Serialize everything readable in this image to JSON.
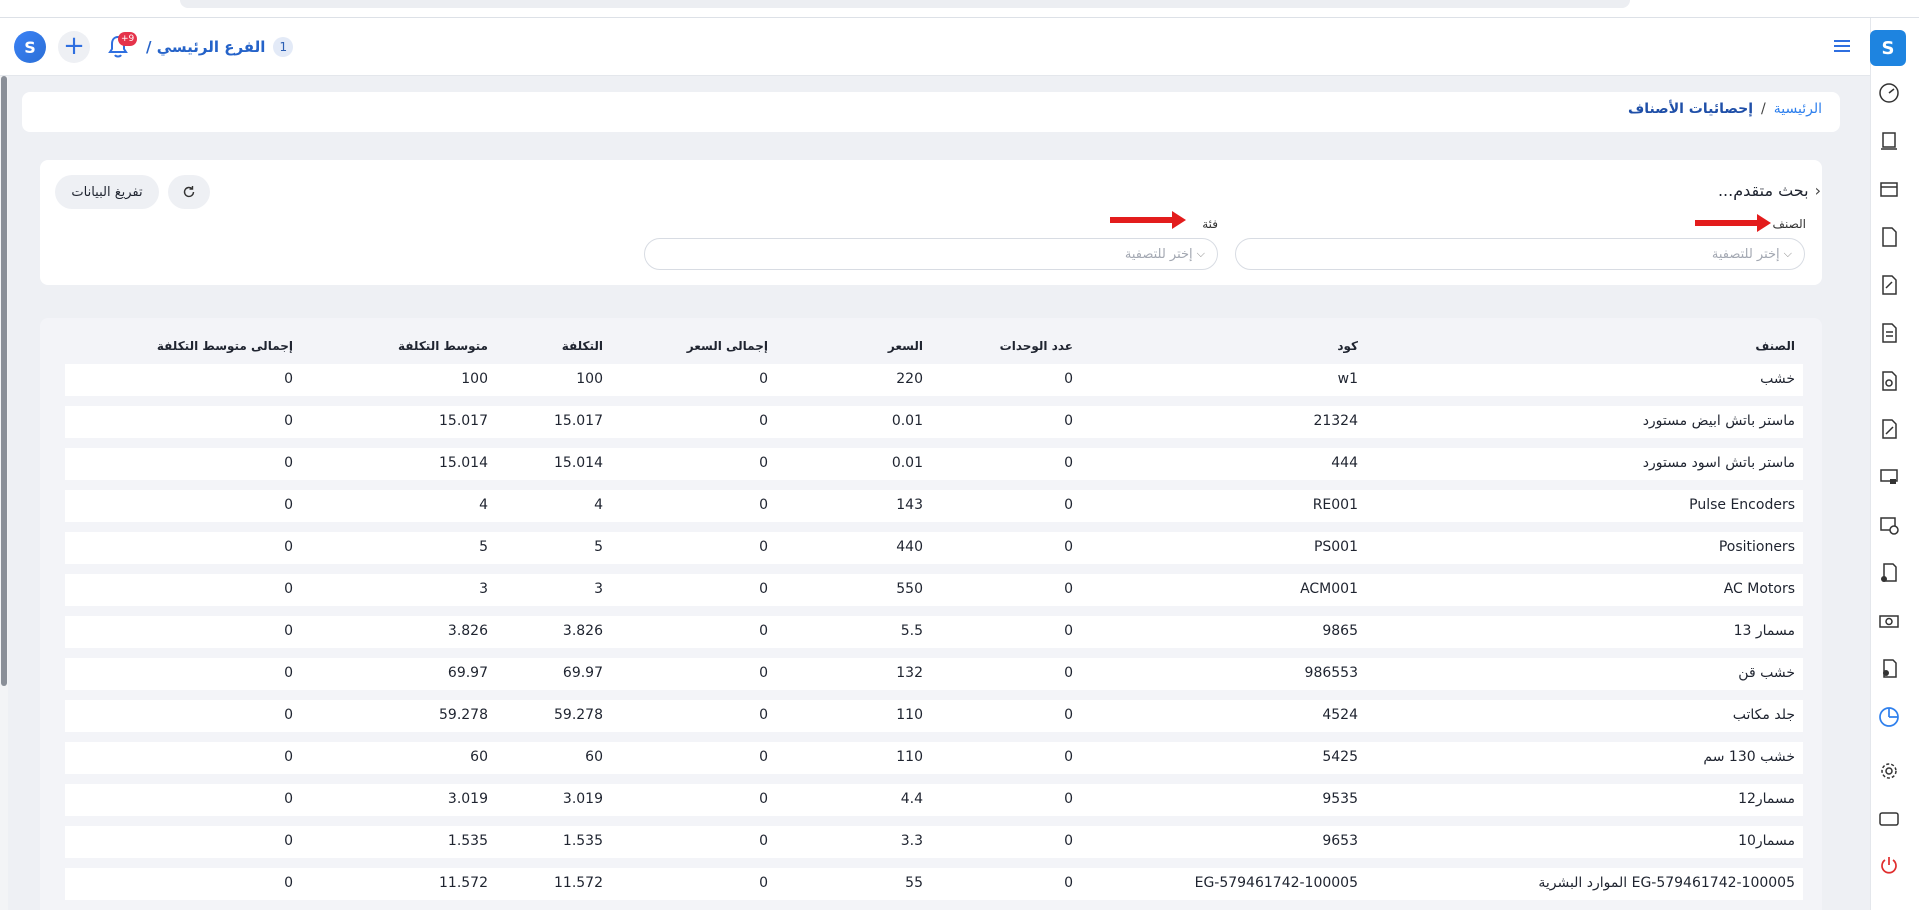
{
  "app": {
    "logo_letter": "S",
    "brand_letter": "S"
  },
  "topbar": {
    "branch_number": "1",
    "branch_name": "الفرع الرئيسي /",
    "notification_count": "+9"
  },
  "breadcrumb": {
    "home": "الرئيسية",
    "separator": "/",
    "current": "إحصائيات الأصناف"
  },
  "filters": {
    "title": "بحث متقدم...",
    "item_label": "الصنف",
    "item_placeholder": "إختر للتصفية",
    "category_label": "فئة",
    "category_placeholder": "إختر للتصفية",
    "export_label": "تفريغ البيانات"
  },
  "table": {
    "headers": {
      "item": "الصنف",
      "code": "كود",
      "units": "عدد الوحدات",
      "price": "السعر",
      "total_price": "إجمالى السعر",
      "cost": "التكلفة",
      "avg_cost": "متوسط التكلفة",
      "total_avg_cost": "إجمالى متوسط التكلفة"
    },
    "rows": [
      {
        "item": "خشب",
        "code": "w1",
        "units": "0",
        "price": "220",
        "total_price": "0",
        "cost": "100",
        "avg_cost": "100",
        "total_avg_cost": "0"
      },
      {
        "item": "ماستر باتش ابيض مستورد",
        "code": "21324",
        "units": "0",
        "price": "0.01",
        "total_price": "0",
        "cost": "15.017",
        "avg_cost": "15.017",
        "total_avg_cost": "0"
      },
      {
        "item": "ماستر باتش اسود مستورد",
        "code": "444",
        "units": "0",
        "price": "0.01",
        "total_price": "0",
        "cost": "15.014",
        "avg_cost": "15.014",
        "total_avg_cost": "0"
      },
      {
        "item": "Pulse Encoders",
        "code": "RE001",
        "units": "0",
        "price": "143",
        "total_price": "0",
        "cost": "4",
        "avg_cost": "4",
        "total_avg_cost": "0"
      },
      {
        "item": "Positioners",
        "code": "PS001",
        "units": "0",
        "price": "440",
        "total_price": "0",
        "cost": "5",
        "avg_cost": "5",
        "total_avg_cost": "0"
      },
      {
        "item": "AC Motors",
        "code": "ACM001",
        "units": "0",
        "price": "550",
        "total_price": "0",
        "cost": "3",
        "avg_cost": "3",
        "total_avg_cost": "0"
      },
      {
        "item": "مسمار 13",
        "code": "9865",
        "units": "0",
        "price": "5.5",
        "total_price": "0",
        "cost": "3.826",
        "avg_cost": "3.826",
        "total_avg_cost": "0"
      },
      {
        "item": "خشب قن",
        "code": "986553",
        "units": "0",
        "price": "132",
        "total_price": "0",
        "cost": "69.97",
        "avg_cost": "69.97",
        "total_avg_cost": "0"
      },
      {
        "item": "جلد مكاتب",
        "code": "4524",
        "units": "0",
        "price": "110",
        "total_price": "0",
        "cost": "59.278",
        "avg_cost": "59.278",
        "total_avg_cost": "0"
      },
      {
        "item": "خشب 130 سم",
        "code": "5425",
        "units": "0",
        "price": "110",
        "total_price": "0",
        "cost": "60",
        "avg_cost": "60",
        "total_avg_cost": "0"
      },
      {
        "item": "مسمار12",
        "code": "9535",
        "units": "0",
        "price": "4.4",
        "total_price": "0",
        "cost": "3.019",
        "avg_cost": "3.019",
        "total_avg_cost": "0"
      },
      {
        "item": "مسمار10",
        "code": "9653",
        "units": "0",
        "price": "3.3",
        "total_price": "0",
        "cost": "1.535",
        "avg_cost": "1.535",
        "total_avg_cost": "0"
      },
      {
        "item": "EG-579461742-100005 الموارد البشرية",
        "code": "EG-579461742-100005",
        "units": "0",
        "price": "55",
        "total_price": "0",
        "cost": "11.572",
        "avg_cost": "11.572",
        "total_avg_cost": "0"
      }
    ]
  },
  "colors": {
    "accent": "#2f80ed",
    "brand": "#1e84e0",
    "badge": "#e5334b",
    "annotation_arrow": "#e31c1c"
  },
  "sidebar_icons": [
    "dashboard-icon",
    "pos-icon",
    "store-icon",
    "invoice-icon",
    "return-icon",
    "document-icon",
    "purchase-icon",
    "purchase-return-icon",
    "cashier-icon",
    "products-icon",
    "add-product-icon",
    "money-icon",
    "users-icon",
    "reports-icon",
    "settings-icon",
    "display-icon",
    "power-icon"
  ]
}
